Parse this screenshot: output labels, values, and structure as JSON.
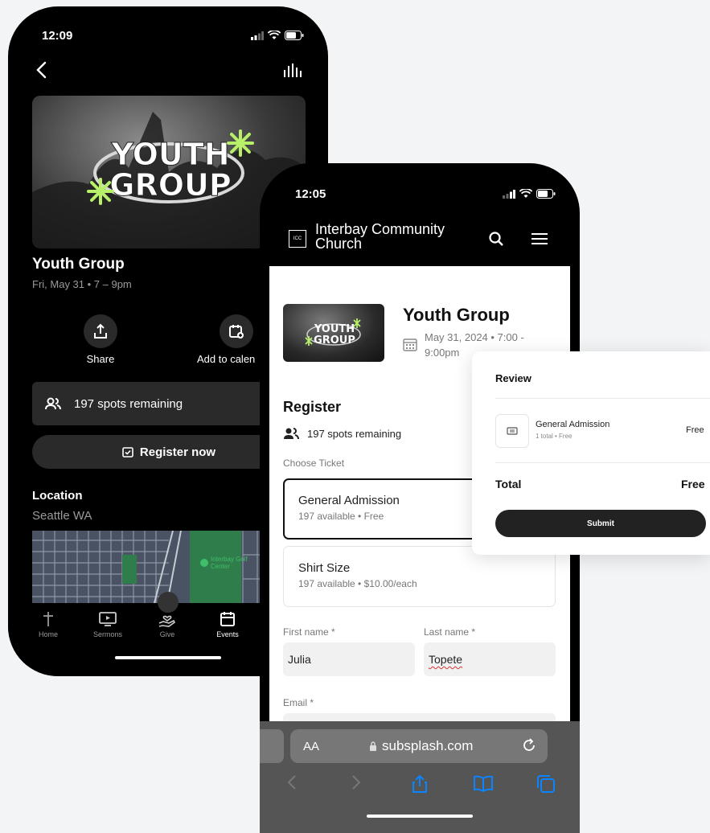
{
  "phone_app": {
    "status_time": "12:09",
    "hero_text_line1": "YOUTH",
    "hero_text_line2": "GROUP",
    "event_title": "Youth Group",
    "event_datetime": "Fri, May 31 • 7 – 9pm",
    "actions": [
      {
        "label": "Share",
        "icon": "share-icon"
      },
      {
        "label": "Add to calen",
        "icon": "calendar-add-icon"
      }
    ],
    "spots_remaining": "197 spots remaining",
    "register_label": "Register now",
    "location_title": "Location",
    "location_value": "Seattle WA",
    "map_poi": "Interbay Golf Center",
    "tabs": [
      {
        "label": "Home",
        "icon": "cross-icon",
        "active": false
      },
      {
        "label": "Sermons",
        "icon": "tv-play-icon",
        "active": false
      },
      {
        "label": "Give",
        "icon": "give-hand-icon",
        "active": false
      },
      {
        "label": "Events",
        "icon": "calendar-icon",
        "active": true
      }
    ]
  },
  "phone_web": {
    "status_time": "12:05",
    "logo_text": "ICC",
    "church_name_line1": "Interbay Community",
    "church_name_line2": "Church",
    "event_title": "Youth Group",
    "event_date_line1": "May 31, 2024 • 7:00 -",
    "event_date_line2": "9:00pm",
    "register_heading": "Register",
    "spots_remaining": "197 spots remaining",
    "choose_ticket_label": "Choose Ticket",
    "tickets": [
      {
        "name": "General Admission",
        "detail": "197 available • Free",
        "selected": true
      },
      {
        "name": "Shirt Size",
        "detail": "197 available • $10.00/each",
        "selected": false
      }
    ],
    "first_name_label": "First name *",
    "first_name_value": "Julia",
    "last_name_label": "Last name *",
    "last_name_value": "Topete",
    "email_label": "Email *",
    "url_aa": "AA",
    "url_host": "subsplash.com"
  },
  "review": {
    "title": "Review",
    "item_name": "General Admission",
    "item_sub": "1 total • Free",
    "item_price": "Free",
    "total_label": "Total",
    "total_value": "Free",
    "submit_label": "Submit"
  },
  "colors": {
    "accent_green": "#b8f06a",
    "dark_surface": "#2a2a2a",
    "ios_blue": "#0a84ff"
  }
}
